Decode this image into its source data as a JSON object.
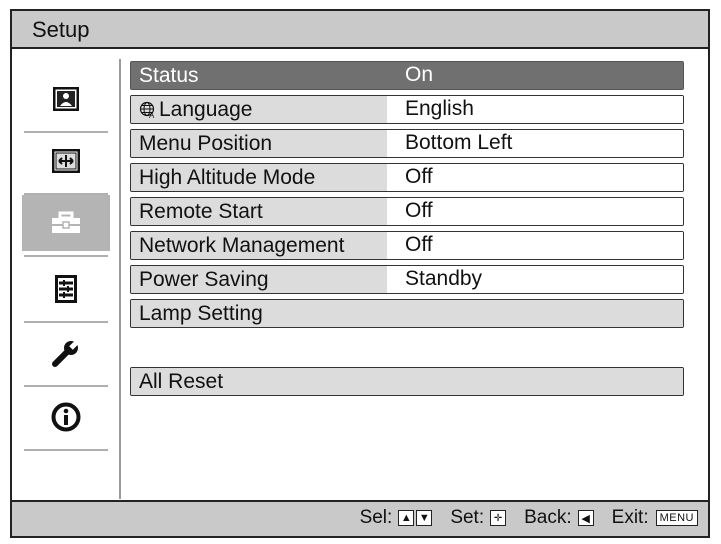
{
  "title": "Setup",
  "sidebar": {
    "items": [
      {
        "icon": "picture-icon"
      },
      {
        "icon": "screen-adjust-icon"
      },
      {
        "icon": "toolbox-icon",
        "selected": true
      },
      {
        "icon": "list-icon"
      },
      {
        "icon": "wrench-icon"
      },
      {
        "icon": "info-icon"
      }
    ]
  },
  "menu": {
    "rows": [
      {
        "label": "Status",
        "value": "On"
      },
      {
        "label": "Language",
        "value": "English"
      },
      {
        "label": "Menu Position",
        "value": "Bottom Left"
      },
      {
        "label": "High Altitude Mode",
        "value": "Off"
      },
      {
        "label": "Remote Start",
        "value": "Off"
      },
      {
        "label": "Network Management",
        "value": "Off"
      },
      {
        "label": "Power Saving",
        "value": "Standby"
      }
    ],
    "lamp_setting": "Lamp Setting",
    "all_reset": "All Reset"
  },
  "footer": {
    "sel_label": "Sel:",
    "set_label": "Set:",
    "back_label": "Back:",
    "exit_label": "Exit:",
    "menu_key": "MENU"
  }
}
